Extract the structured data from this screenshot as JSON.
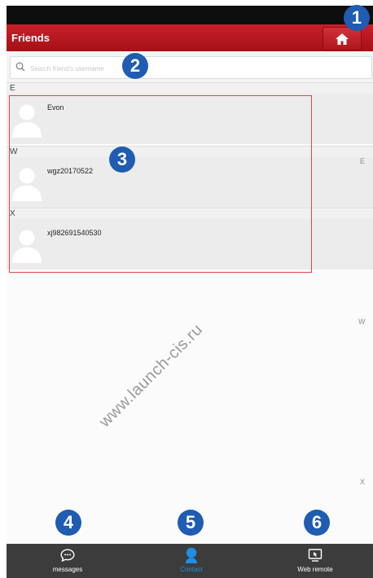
{
  "header": {
    "title": "Friends",
    "home_icon": "home-icon"
  },
  "search": {
    "placeholder": "Search friend's username",
    "value": "",
    "icon": "search-icon"
  },
  "sections": [
    {
      "letter": "E",
      "contacts": [
        {
          "name": "Evon",
          "avatar_icon": "default-avatar-icon"
        }
      ]
    },
    {
      "letter": "W",
      "contacts": [
        {
          "name": "wgz20170522",
          "avatar_icon": "default-avatar-icon"
        }
      ]
    },
    {
      "letter": "X",
      "contacts": [
        {
          "name": "xj982691540530",
          "avatar_icon": "default-avatar-icon"
        }
      ]
    }
  ],
  "index_bar": [
    "E",
    "W",
    "X"
  ],
  "callouts": [
    "1",
    "2",
    "3",
    "4",
    "5",
    "6"
  ],
  "bottom_nav": [
    {
      "label": "messages",
      "icon": "chat-bubble-icon",
      "active": false
    },
    {
      "label": "Contact",
      "icon": "contact-person-icon",
      "active": true
    },
    {
      "label": "Web remote",
      "icon": "remote-screen-icon",
      "active": false
    }
  ],
  "watermark": "www.launch-cis.ru",
  "colors": {
    "header_red": "#b5161d",
    "active_blue": "#1d8fe6",
    "nav_bg": "#3c3c3c",
    "callout_blue": "#1f5cb2",
    "highlight_box": "#e0464b"
  }
}
